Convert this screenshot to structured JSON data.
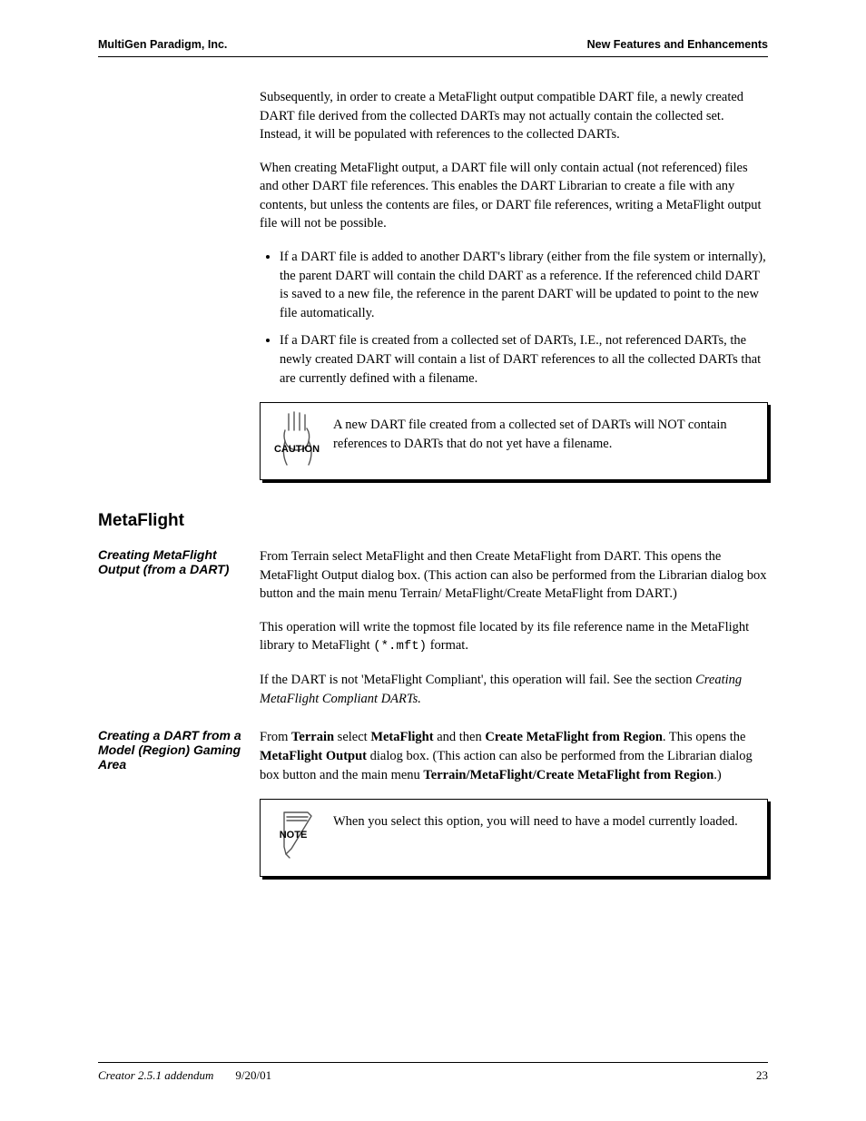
{
  "header": {
    "left": "MultiGen Paradigm, Inc.",
    "right": "New Features and Enhancements"
  },
  "intro": {
    "paragraphs": [
      "Subsequently, in order to create a MetaFlight output compatible DART file, a newly created DART file derived from the collected DARTs may not actually contain the collected set. Instead, it will be populated with references to the collected DARTs.",
      "When creating MetaFlight output, a DART file will only contain actual (not referenced) files and other DART file references. This enables the DART Librarian to create a file with any contents, but unless the contents are files, or DART file references, writing a MetaFlight output file will not be possible."
    ],
    "bullets": [
      "If a DART file is added to another DART's library (either from the file system or internally), the parent DART will contain the child DART as a reference. If the referenced child DART is saved to a new file, the reference in the parent DART will be updated to point to the new file automatically.",
      "If a DART file is created from a collected set of DARTs, I.E., not referenced DARTs, the newly created DART will contain a list of DART references to all the collected DARTs that are currently defined with a filename."
    ]
  },
  "callouts": {
    "caution_text": "A new DART file created from a collected set of DARTs will NOT contain references to DARTs that do not yet have a filename.",
    "note_text": "When you select this option, you will need to have a model currently loaded."
  },
  "section": {
    "heading": "MetaFlight",
    "left_label_1": "Creating MetaFlight Output (from a DART)",
    "para_1": "From Terrain select MetaFlight and then Create MetaFlight from DART. This opens the MetaFlight Output dialog box. (This action can also be performed from the Librarian dialog box button and the main menu Terrain/ MetaFlight/Create MetaFlight from DART.)",
    "para_2_parts": [
      "This operation will write the topmost file located by its file reference name in the MetaFlight library to MetaFlight ",
      "(*.mft)",
      " format."
    ],
    "para_3_parts": [
      "If the DART is not 'MetaFlight Compliant', this operation will fail. See the section ",
      "Creating MetaFlight Compliant DARTs."
    ],
    "left_label_2": "Creating a DART from a Model (Region) Gaming Area",
    "para_4_parts": [
      "From ",
      "Terrain",
      " select ",
      "MetaFlight",
      " and then ",
      "Create MetaFlight from Region",
      ". This opens the ",
      "MetaFlight Output",
      " dialog box. (This action can also be performed from the Librarian dialog box button and the main menu ",
      "Terrain/MetaFlight/Create MetaFlight from Region",
      ".)"
    ]
  },
  "footer": {
    "left": "Creator 2.5.1 addendum",
    "middle": "9/20/01",
    "right": "23"
  }
}
